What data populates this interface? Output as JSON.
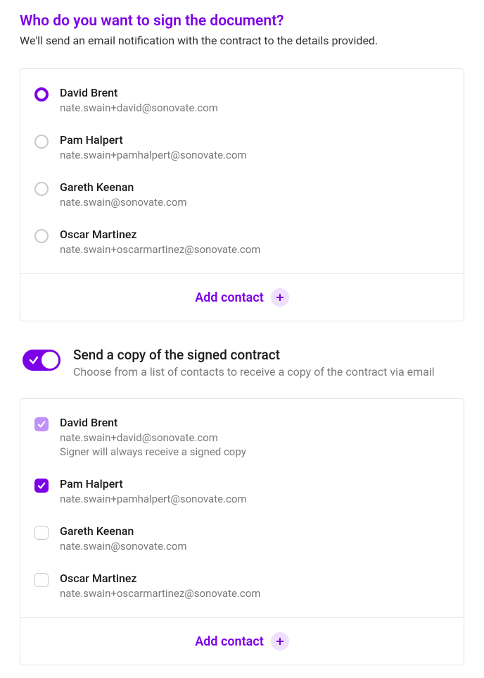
{
  "header": {
    "title": "Who do you want to sign the document?",
    "subtitle": "We'll send an email notification with the contract to the details provided."
  },
  "signers": {
    "contacts": [
      {
        "name": "David Brent",
        "email": "nate.swain+david@sonovate.com",
        "selected": true
      },
      {
        "name": "Pam Halpert",
        "email": "nate.swain+pamhalpert@sonovate.com",
        "selected": false
      },
      {
        "name": "Gareth Keenan",
        "email": "nate.swain@sonovate.com",
        "selected": false
      },
      {
        "name": "Oscar Martinez",
        "email": "nate.swain+oscarmartinez@sonovate.com",
        "selected": false
      }
    ],
    "add_button": "Add contact"
  },
  "copy_toggle": {
    "enabled": true,
    "title": "Send a copy of the signed contract",
    "description": "Choose from a list of contacts to receive a copy of the contract via email"
  },
  "recipients": {
    "contacts": [
      {
        "name": "David Brent",
        "email": "nate.swain+david@sonovate.com",
        "checked": true,
        "locked": true,
        "note": "Signer will always receive a signed copy"
      },
      {
        "name": "Pam Halpert",
        "email": "nate.swain+pamhalpert@sonovate.com",
        "checked": true,
        "locked": false
      },
      {
        "name": "Gareth Keenan",
        "email": "nate.swain@sonovate.com",
        "checked": false,
        "locked": false
      },
      {
        "name": "Oscar Martinez",
        "email": "nate.swain+oscarmartinez@sonovate.com",
        "checked": false,
        "locked": false
      }
    ],
    "add_button": "Add contact"
  }
}
